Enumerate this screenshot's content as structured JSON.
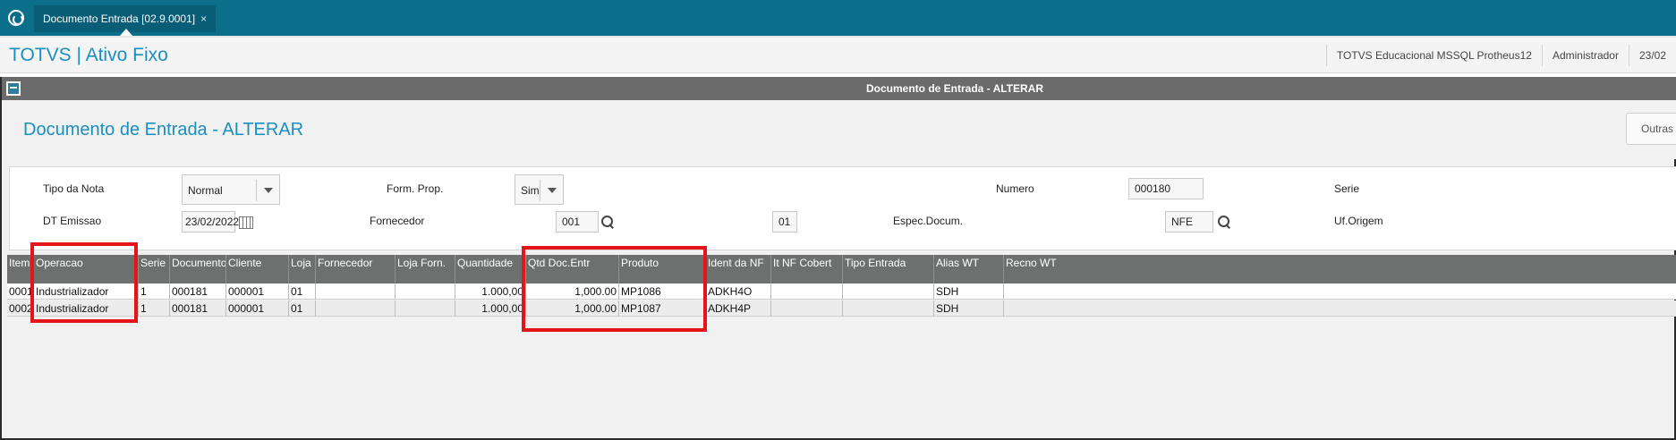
{
  "tabbar": {
    "tab_label": "Documento Entrada [02.9.0001]",
    "tab_close": "×"
  },
  "header": {
    "app_title": "TOTVS | Ativo Fixo",
    "environment": "TOTVS Educacional MSSQL Protheus12",
    "user": "Administrador",
    "date": "23/02"
  },
  "window": {
    "title": "Documento de Entrada - ALTERAR",
    "dialog_title": "Documento de Entrada - ALTERAR",
    "outras_label": "Outras A"
  },
  "form": {
    "tipo_nota_label": "Tipo da Nota",
    "tipo_nota_value": "Normal",
    "form_prop_label": "Form. Prop.",
    "form_prop_value": "Sim",
    "numero_label": "Numero",
    "numero_value": "000180",
    "serie_label": "Serie",
    "dt_emissao_label": "DT Emissao",
    "dt_emissao_value": "23/02/2022",
    "fornecedor_label": "Fornecedor",
    "fornecedor_value": "001",
    "loja_value": "01",
    "espec_label": "Espec.Docum.",
    "espec_value": "NFE",
    "uf_origem_label": "Uf.Origem"
  },
  "grid": {
    "columns": [
      "Item",
      "Operacao",
      "Serie",
      "Documento",
      "Cliente",
      "Loja",
      "Fornecedor",
      "Loja Forn.",
      "Quantidade",
      "Qtd Doc.Entr",
      "Produto",
      "Ident da NF",
      "It NF Cobert",
      "Tipo Entrada",
      "Alias WT",
      "Recno WT"
    ],
    "rows": [
      [
        "0001",
        "Industrializador",
        "1",
        "000181",
        "000001",
        "01",
        "",
        "",
        "1.000,00",
        "1,000.00",
        "MP1086",
        "ADKH4O",
        "",
        "",
        "SDH",
        ""
      ],
      [
        "0002",
        "Industrializador",
        "1",
        "000181",
        "000001",
        "01",
        "",
        "",
        "1.000,00",
        "1,000.00",
        "MP1087",
        "ADKH4P",
        "",
        "",
        "SDH",
        ""
      ]
    ]
  },
  "colors": {
    "topbar": "#0b6e8a",
    "accent": "#1a8fc0",
    "grid_header": "#6e7070",
    "highlight": "#e4141a"
  },
  "icons": [
    "home-icon",
    "close-icon",
    "window-icon",
    "dropdown-arrow-icon",
    "calendar-icon",
    "search-icon"
  ]
}
